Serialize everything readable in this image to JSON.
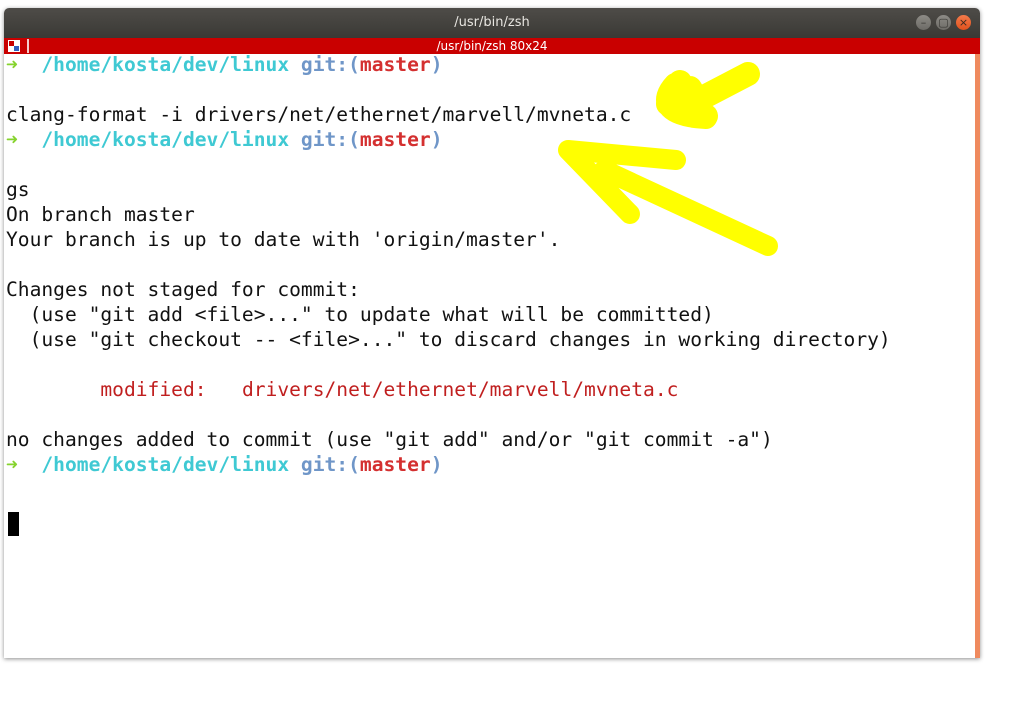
{
  "window": {
    "title": "/usr/bin/zsh",
    "minimize_glyph": "–",
    "maximize_glyph": "▢",
    "close_glyph": "×"
  },
  "tab": {
    "title": "/usr/bin/zsh 80x24",
    "icon": "terminator-icon"
  },
  "prompt": {
    "arrow": "➜",
    "path": "/home/kosta/dev/linux",
    "git_label": "git:(",
    "branch": "master",
    "git_close": ")"
  },
  "terminal": {
    "cmd1": "clang-format -i drivers/net/ethernet/marvell/mvneta.c",
    "cmd2": "gs",
    "out1": "On branch master",
    "out2": "Your branch is up to date with 'origin/master'.",
    "out3": "Changes not staged for commit:",
    "out4": "  (use \"git add <file>...\" to update what will be committed)",
    "out5": "  (use \"git checkout -- <file>...\" to discard changes in working directory)",
    "modified_label": "modified:",
    "modified_file": "drivers/net/ethernet/marvell/mvneta.c",
    "out7": "no changes added to commit (use \"git add\" and/or \"git commit -a\")"
  },
  "colors": {
    "tab_bar": "#c90000",
    "prompt_arrow": "#86d32e",
    "prompt_path": "#3fc9d3",
    "git_label": "#6f96c8",
    "branch": "#d43030",
    "annotation": "#ffff00",
    "scrollbar": "#ef8a5e"
  }
}
